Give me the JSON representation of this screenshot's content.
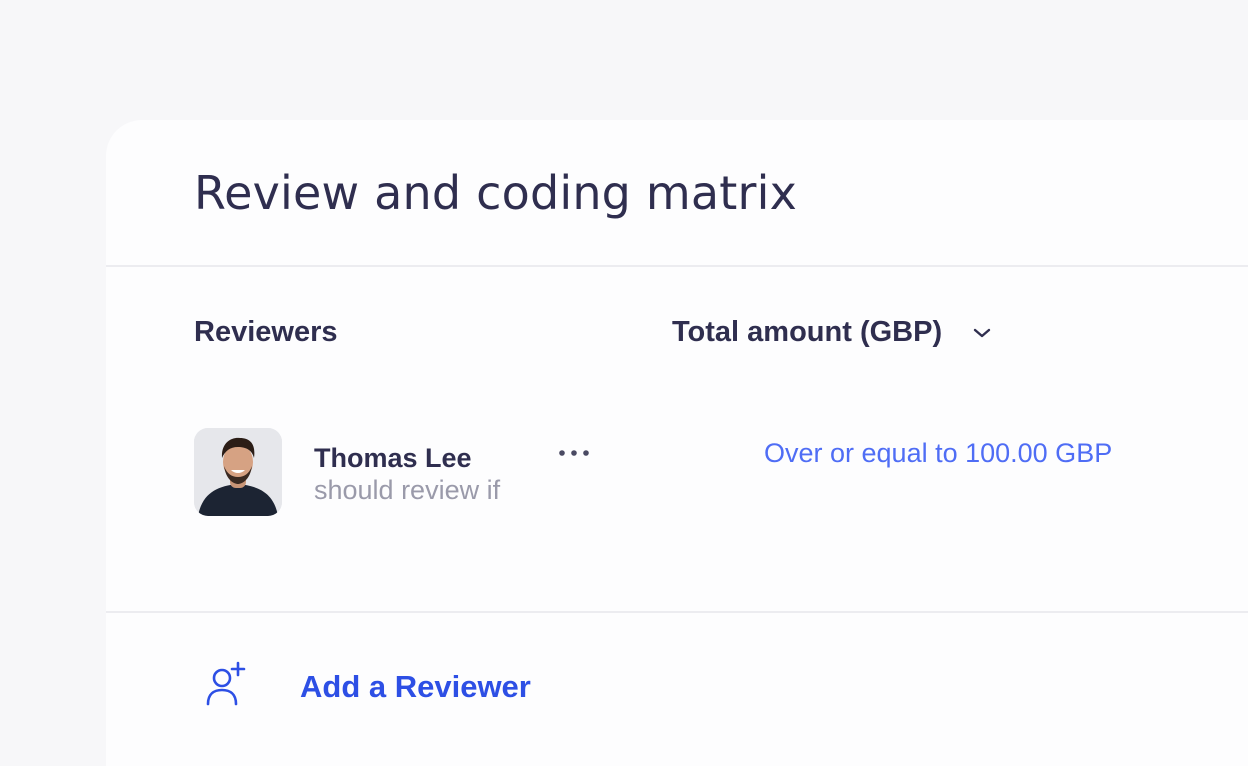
{
  "panel": {
    "title": "Review and coding matrix"
  },
  "table": {
    "columns": [
      "Reviewers",
      "Total amount (GBP)"
    ],
    "rows": [
      {
        "reviewer_name": "Thomas Lee",
        "reviewer_caption": "should review if",
        "condition": "Over or equal to 100.00 GBP"
      }
    ]
  },
  "actions": {
    "add_reviewer_label": "Add a Reviewer"
  },
  "colors": {
    "accent": "#2d4fe5",
    "link": "#4f6df5",
    "text_primary": "#2f2e4f",
    "text_secondary": "#9a9aaa"
  },
  "icons": {
    "dropdown": "chevron-down-icon",
    "row_menu": "more-horizontal-icon",
    "add_reviewer": "user-plus-icon"
  }
}
